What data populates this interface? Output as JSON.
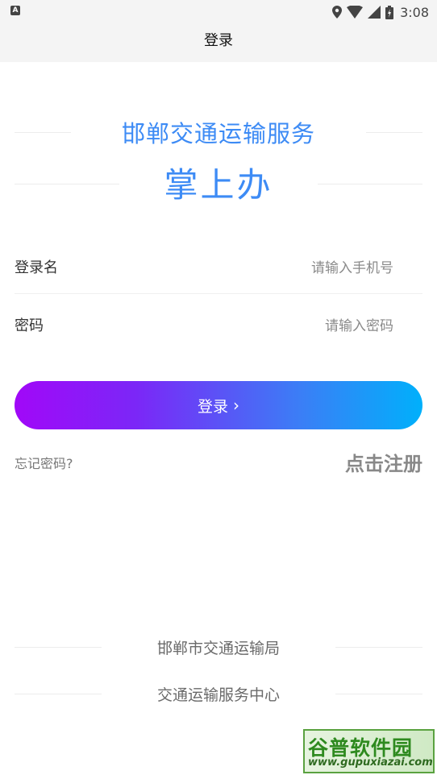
{
  "status_bar": {
    "left_icon": "A",
    "time": "3:08",
    "icons": [
      "location-icon",
      "wifi-icon",
      "signal-icon",
      "battery-icon"
    ]
  },
  "header": {
    "title": "登录"
  },
  "brand": {
    "line1": "邯郸交通运输服务",
    "line2": "掌上办",
    "color": "#3d8bf5"
  },
  "form": {
    "username_label": "登录名",
    "username_placeholder": "请输入手机号",
    "password_label": "密码",
    "password_placeholder": "请输入密码",
    "login_label": "登录",
    "forgot_label": "忘记密码?",
    "register_label": "点击注册"
  },
  "footer": {
    "line1": "邯郸市交通运输局",
    "line2": "交通运输服务中心"
  },
  "watermark": {
    "title": "谷普软件园",
    "url": "www.gupuxiazai.com"
  },
  "colors": {
    "button_gradient_start": "#a108f8",
    "button_gradient_end": "#00b0fb"
  }
}
